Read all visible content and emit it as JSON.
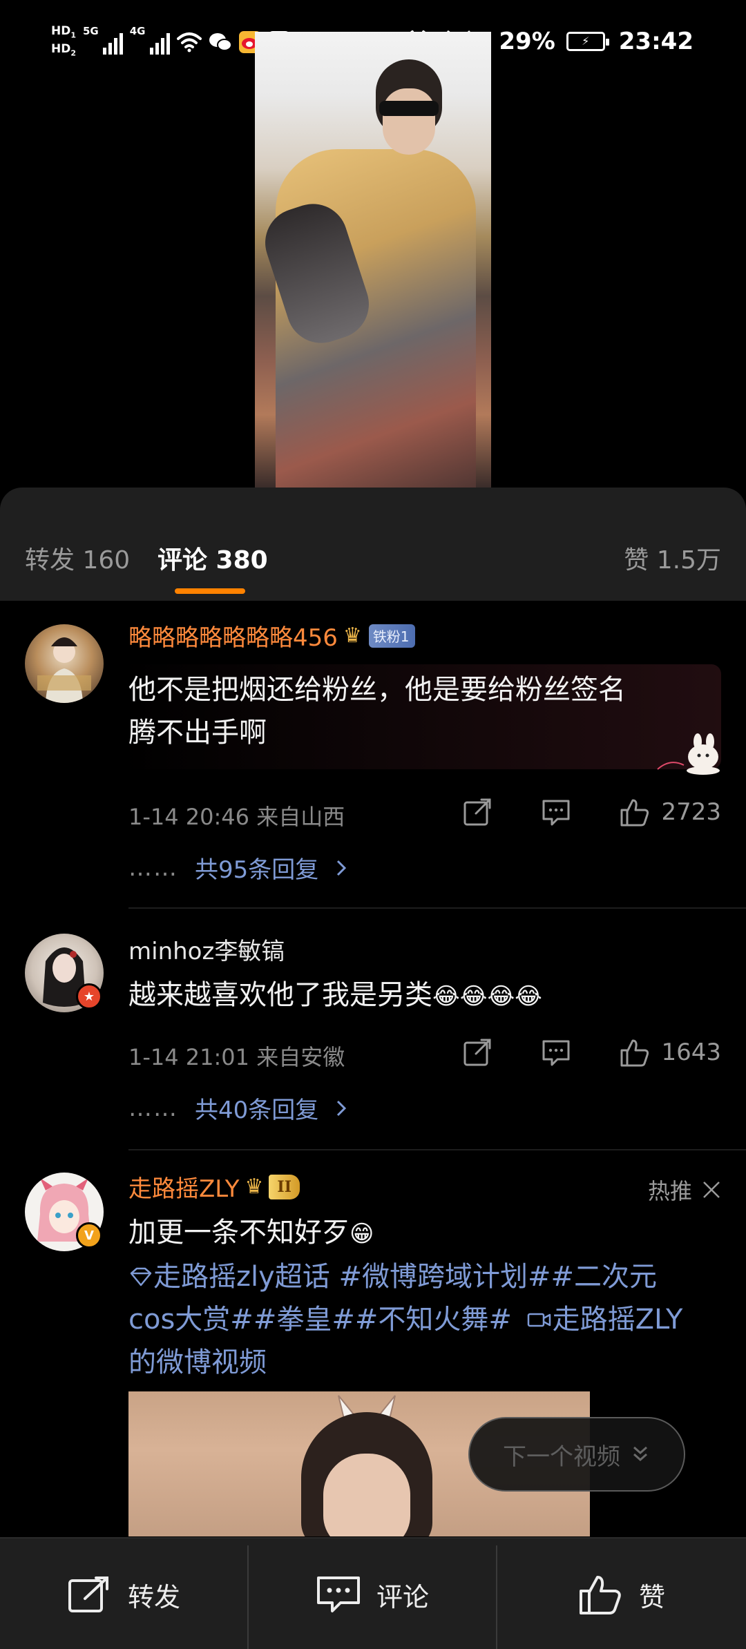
{
  "status_bar": {
    "hd1": "HD",
    "hd1_sub": "1",
    "hd2": "HD",
    "hd2_sub": "2",
    "net1": "5G",
    "net2": "4G",
    "battery_percent": "29%",
    "time": "23:42"
  },
  "tabs": {
    "repost": "转发 160",
    "comments": "评论 380",
    "likes": "赞 1.5万"
  },
  "comments": [
    {
      "username": "略略略略略略略456",
      "fan_badge": "铁粉1",
      "text_line1": "他不是把烟还给粉丝，他是要给粉丝签名",
      "text_line2": "腾不出手啊",
      "time_location": "1-14 20:46 来自山西",
      "like_count": "2723",
      "replies_dots": "……",
      "replies_link": "共95条回复"
    },
    {
      "username": "minhoz李敏镐",
      "text": "越来越喜欢他了我是另类",
      "emoji": "😂😂😂😂",
      "time_location": "1-14 21:01 来自安徽",
      "like_count": "1643",
      "replies_dots": "……",
      "replies_link": "共40条回复"
    },
    {
      "username": "走路摇ZLY",
      "level_badge": "II",
      "hot_label": "热推",
      "text": "加更一条不知好歹",
      "emoji": "😁",
      "line2_link1": "走路摇zly超话",
      "line2_link2": "#微博跨域计划##二次元",
      "line3_link1": "cos大赏##拳皇##不知火舞#",
      "line3_link2": "走路摇ZLY",
      "line4_link": "的微博视频"
    }
  ],
  "next_video": "下一个视频",
  "bottom_bar": {
    "repost": "转发",
    "comment": "评论",
    "like": "赞"
  },
  "colors": {
    "accent": "#ff8200",
    "username_vip": "#ff8a3c",
    "link": "#7f9bd6",
    "sheet_bg": "#1f1f1f"
  }
}
